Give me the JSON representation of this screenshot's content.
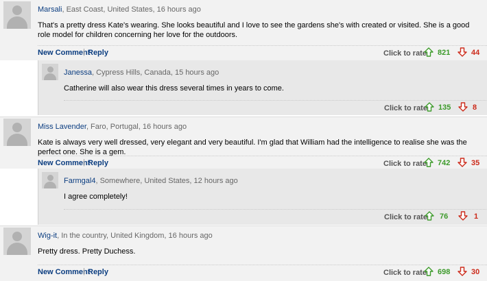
{
  "actions": {
    "new_comment": "New Comment",
    "reply": "Reply",
    "separator": "|",
    "rate": "Click to rate"
  },
  "colors": {
    "up": "#3c9a2a",
    "down": "#cc2a1a",
    "link": "#0b3d80"
  },
  "icons": {
    "up": "arrow-up-icon",
    "down": "arrow-down-icon",
    "avatar": "avatar-placeholder-icon"
  },
  "comments": [
    {
      "user": "Marsali",
      "location": ", East Coast, United States, 16 hours ago",
      "text": "That's a pretty dress Kate's wearing. She looks beautiful and I love to see the gardens she's with created or visited. She is a good role model for children concerning her love for the outdoors.",
      "up": "821",
      "down": "44"
    },
    {
      "user": "Janessa",
      "location": ", Cypress Hills, Canada, 15 hours ago",
      "text": "Catherine will also wear this dress several times in years to come.",
      "up": "135",
      "down": "8"
    },
    {
      "user": "Miss Lavender",
      "location": ", Faro, Portugal, 16 hours ago",
      "text": "Kate is always very well dressed, very elegant and very beautiful. I'm glad that William had the intelligence to realise she was the perfect one. She is a gem.",
      "up": "742",
      "down": "35"
    },
    {
      "user": "Farmgal4",
      "location": ", Somewhere, United States, 12 hours ago",
      "text": "I agree completely!",
      "up": "76",
      "down": "1"
    },
    {
      "user": "Wig-it",
      "location": ", In the country, United Kingdom, 16 hours ago",
      "text": "Pretty dress. Pretty Duchess.",
      "up": "698",
      "down": "30"
    }
  ]
}
